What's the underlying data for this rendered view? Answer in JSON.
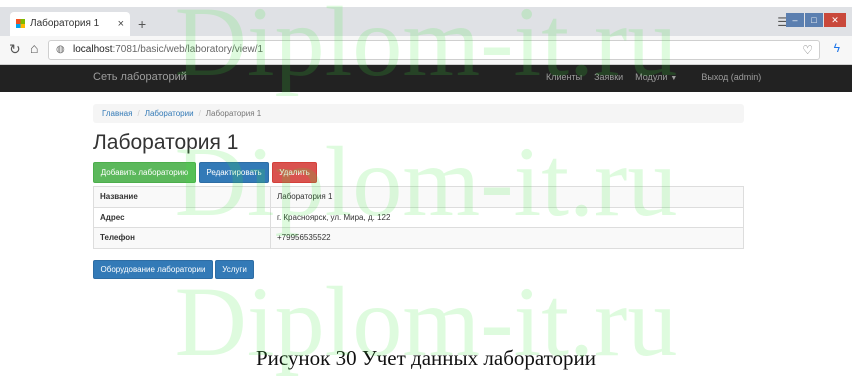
{
  "browser": {
    "tab_title": "Лаборатория 1",
    "tab_close": "×",
    "new_tab": "+",
    "url_host": "localhost",
    "url_rest": ":7081/basic/web/laboratory/view/1"
  },
  "navbar": {
    "brand": "Сеть лабораторий",
    "items": [
      "Клиенты",
      "Заявки",
      "Модули",
      "Выход (admin)"
    ]
  },
  "breadcrumb": [
    "Главная",
    "Лаборатории",
    "Лаборатория 1"
  ],
  "page": {
    "title": "Лаборатория 1",
    "buttons": {
      "add": "Добавить лабораторию",
      "edit": "Редактировать",
      "delete": "Удалить"
    },
    "details": [
      {
        "label": "Название",
        "value": "Лаборатория 1"
      },
      {
        "label": "Адрес",
        "value": "г. Красноярск, ул. Мира, д. 122"
      },
      {
        "label": "Телефон",
        "value": "+79956535522"
      }
    ],
    "bottom_buttons": {
      "equipment": "Оборудование лаборатории",
      "services": "Услуги"
    }
  },
  "caption": "Рисунок 30 Учет данных лаборатории",
  "watermark": "Diplom-it.ru",
  "colors": {
    "success": "#5cb85c",
    "primary": "#337ab7",
    "danger": "#d9534f",
    "navbar": "#222222",
    "watermark": "#3ce63c"
  }
}
